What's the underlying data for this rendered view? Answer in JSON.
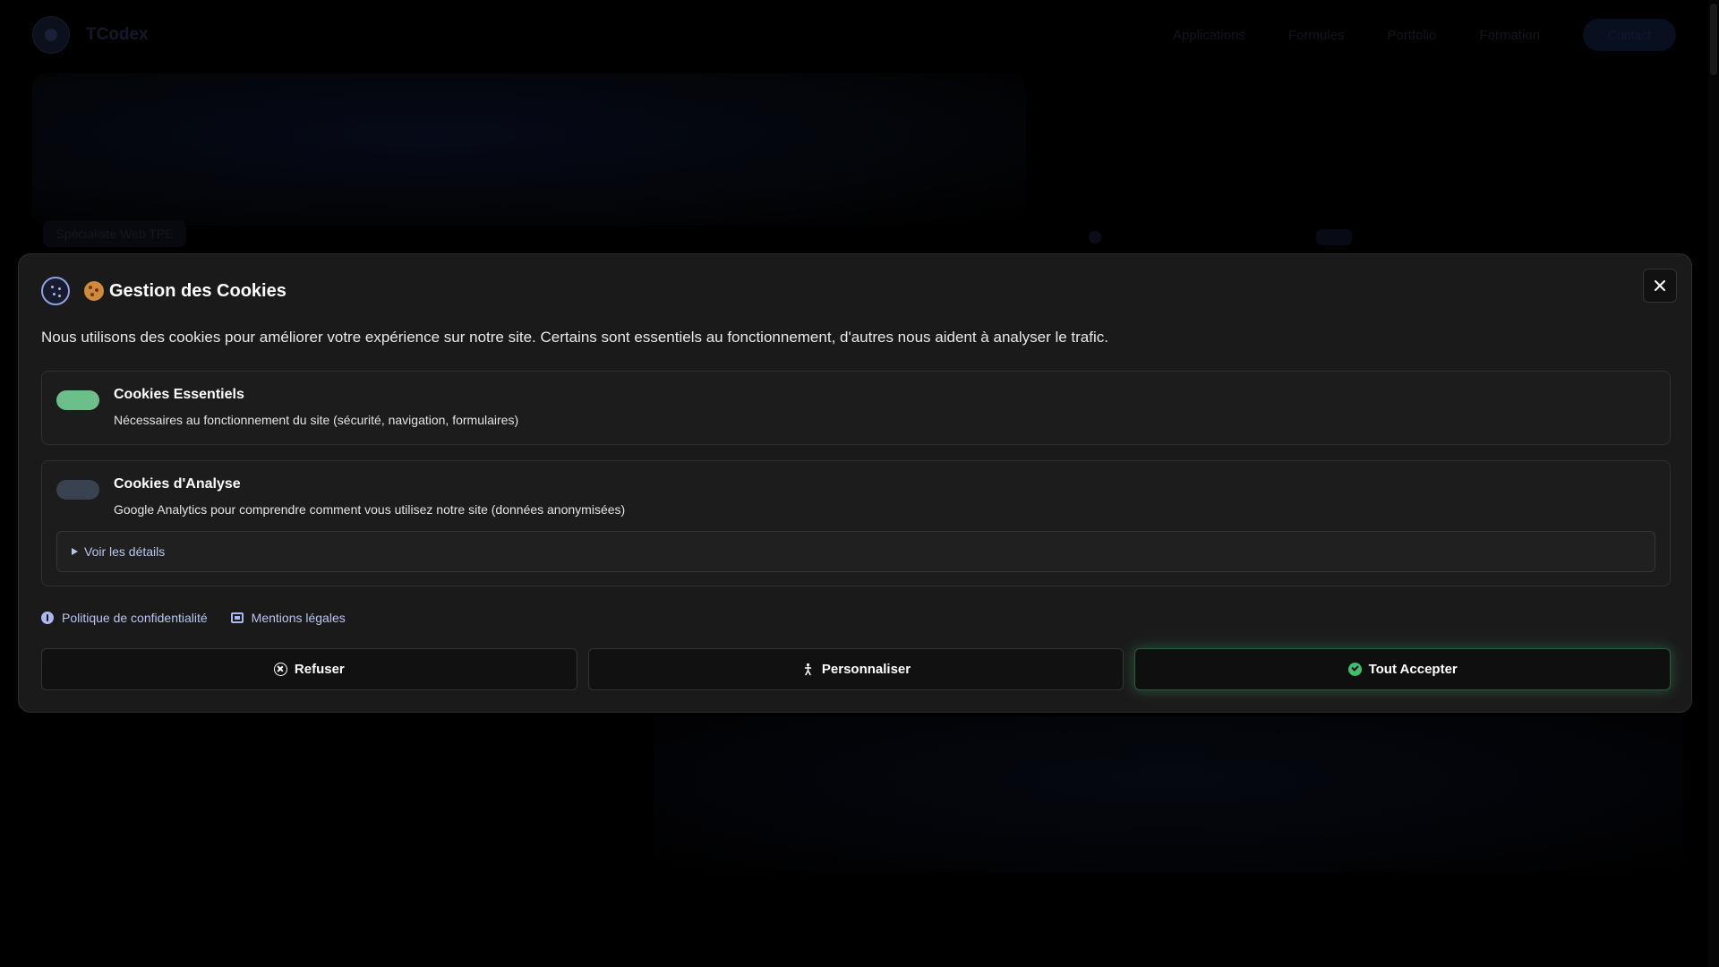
{
  "background": {
    "brand": "TCodex",
    "nav": [
      "Applications",
      "Formules",
      "Portfolio",
      "Formation"
    ],
    "cta": "Contact",
    "badge": "Spécialiste Web TPE"
  },
  "modal": {
    "title": "Gestion des Cookies",
    "intro": "Nous utilisons des cookies pour améliorer votre expérience sur notre site. Certains sont essentiels au fonctionnement, d'autres nous aident à analyser le trafic.",
    "categories": [
      {
        "title": "Cookies Essentiels",
        "description": "Nécessaires au fonctionnement du site (sécurité, navigation, formulaires)",
        "enabled": true
      },
      {
        "title": "Cookies d'Analyse",
        "description": "Google Analytics pour comprendre comment vous utilisez notre site (données anonymisées)",
        "enabled": false,
        "details_label": "Voir les détails"
      }
    ],
    "links": {
      "privacy": "Politique de confidentialité",
      "legal": "Mentions légales"
    },
    "buttons": {
      "refuse": "Refuser",
      "customize": "Personnaliser",
      "accept_all": "Tout Accepter"
    }
  },
  "colors": {
    "accent": "#b9c6ee",
    "toggle_on": "#6dbf8a",
    "toggle_off": "#3a4150",
    "accept_glow": "#3fbf6a"
  },
  "icons": {
    "cookie_logo": "cookie-icon",
    "close": "close-icon",
    "privacy": "info-icon",
    "legal": "document-icon",
    "refuse": "x-circle-icon",
    "customize": "accessibility-icon",
    "accept": "check-circle-icon"
  }
}
